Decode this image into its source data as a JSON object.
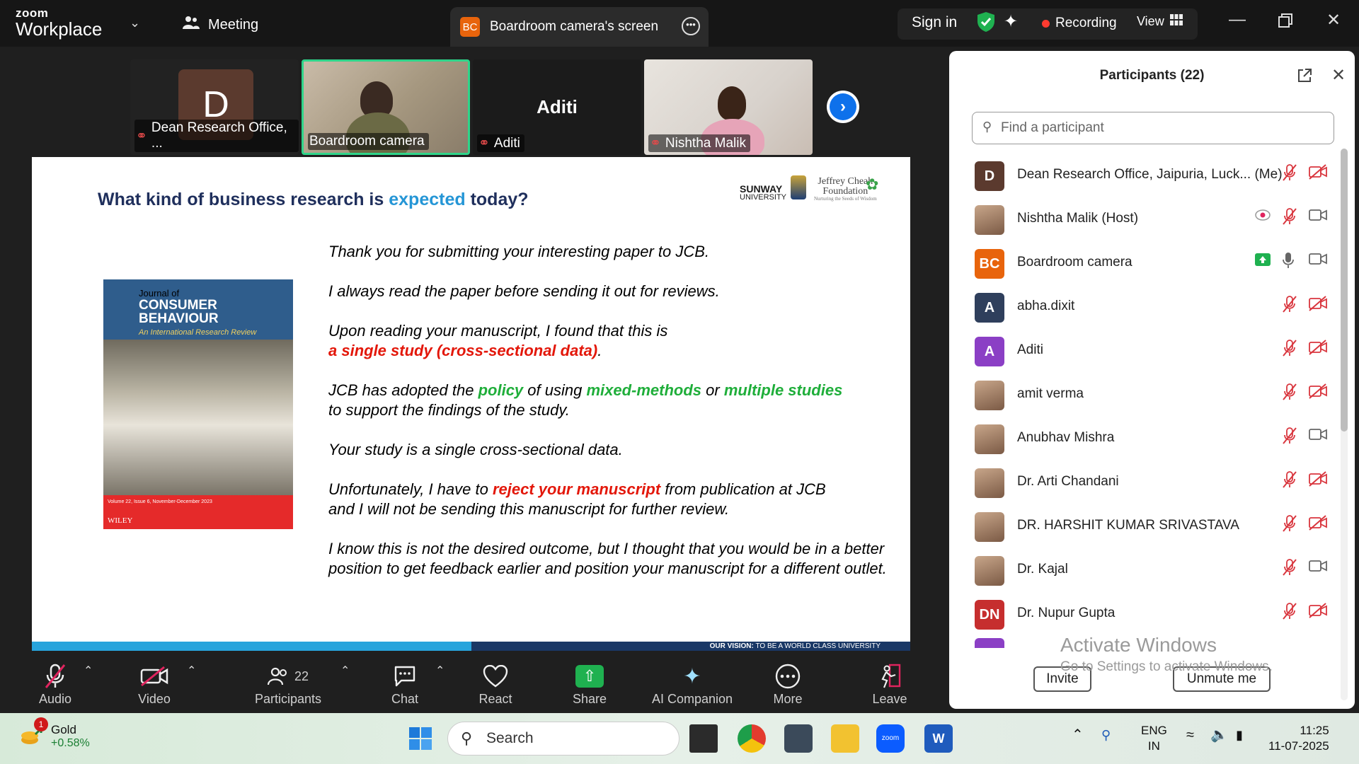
{
  "titlebar": {
    "logo_top": "zoom",
    "logo_bottom": "Workplace",
    "meeting_label": "Meeting",
    "tab_initials": "BC",
    "tab_title": "Boardroom camera's screen",
    "sign_in": "Sign in",
    "recording": "Recording",
    "view": "View"
  },
  "thumbnails": [
    {
      "initial": "D",
      "name": "Dean Research Office, ..."
    },
    {
      "name": "Boardroom camera"
    },
    {
      "big_name": "Aditi",
      "name": "Aditi"
    },
    {
      "name": "Nishtha Malik"
    }
  ],
  "slide": {
    "title_a": "What kind of business research is ",
    "title_hl": "expected",
    "title_b": " today?",
    "brand1_top": "SUNWAY",
    "brand1_bottom": "UNIVERSITY",
    "brand2_top": "Jeffrey Cheah",
    "brand2_mid": "Foundation",
    "brand2_small": "Nurturing the Seeds of Wisdom",
    "cover_j1": "Journal of",
    "cover_j2a": "CONSUMER",
    "cover_j2b": "BEHAVIOUR",
    "cover_j3": "An International Research Review",
    "cover_fine": "Volume 22, Issue 6, November-December 2023",
    "cover_publisher": "WILEY",
    "p1": "Thank you for submitting your interesting paper to JCB.",
    "p2": "I always read the paper before sending it out for reviews.",
    "p3a": "Upon reading your manuscript, I found that this is",
    "p3b": "a single study (cross-sectional data)",
    "p3c": ".",
    "p4a": "JCB has adopted the ",
    "p4b": "policy",
    "p4c": " of using ",
    "p4d": "mixed-methods",
    "p4e": " or ",
    "p4f": "multiple studies",
    "p4g": "to support the findings of the study.",
    "p5": "Your study is a single cross-sectional data.",
    "p6a": "Unfortunately, I have to ",
    "p6b": "reject your manuscript",
    "p6c": " from publication at JCB",
    "p6d": "and I will not be sending this manuscript for further review.",
    "p7": "I know this is not the desired outcome, but I thought that you would be in a better position to get feedback earlier and position your manuscript for a different outlet.",
    "vision_label": "OUR VISION:",
    "vision_text": " TO BE A WORLD CLASS UNIVERSITY"
  },
  "toolbar": {
    "audio": "Audio",
    "video": "Video",
    "participants": "Participants",
    "participants_count": "22",
    "chat": "Chat",
    "react": "React",
    "share": "Share",
    "ai": "AI Companion",
    "more": "More",
    "leave": "Leave"
  },
  "panel": {
    "title": "Participants (22)",
    "search_placeholder": "Find a participant",
    "participants": [
      {
        "initials": "D",
        "color": "#5b3a2e",
        "name": "Dean Research Office, Jaipuria, Luck...  (Me)",
        "mic": "muted",
        "cam": "off"
      },
      {
        "initials": "",
        "color": "",
        "name": "Nishtha Malik (Host)",
        "mic": "muted",
        "cam": "on",
        "extra": "recording"
      },
      {
        "initials": "BC",
        "color": "#e8640c",
        "name": "Boardroom camera",
        "mic": "on",
        "cam": "on",
        "extra": "sharing"
      },
      {
        "initials": "A",
        "color": "#2f3f5c",
        "name": "abha.dixit",
        "mic": "muted",
        "cam": "off"
      },
      {
        "initials": "A",
        "color": "#8b3fc5",
        "name": "Aditi",
        "mic": "muted",
        "cam": "off"
      },
      {
        "initials": "",
        "color": "",
        "name": "amit verma",
        "mic": "muted",
        "cam": "off"
      },
      {
        "initials": "",
        "color": "",
        "name": "Anubhav Mishra",
        "mic": "muted",
        "cam": "on"
      },
      {
        "initials": "",
        "color": "",
        "name": "Dr. Arti Chandani",
        "mic": "muted",
        "cam": "off"
      },
      {
        "initials": "",
        "color": "",
        "name": "DR. HARSHIT KUMAR SRIVASTAVA",
        "mic": "muted",
        "cam": "off"
      },
      {
        "initials": "",
        "color": "",
        "name": "Dr. Kajal",
        "mic": "muted",
        "cam": "on"
      },
      {
        "initials": "DN",
        "color": "#c62e2e",
        "name": "Dr. Nupur Gupta",
        "mic": "muted",
        "cam": "off"
      }
    ],
    "invite": "Invite",
    "unmute_me": "Unmute me"
  },
  "watermark": {
    "line1": "Activate Windows",
    "line2": "Go to Settings to activate Windows."
  },
  "taskbar": {
    "widget_badge": "1",
    "widget_title": "Gold",
    "widget_value": "+0.58%",
    "search": "Search",
    "lang1": "ENG",
    "lang2": "IN",
    "time": "11:25",
    "date": "11-07-2025"
  }
}
